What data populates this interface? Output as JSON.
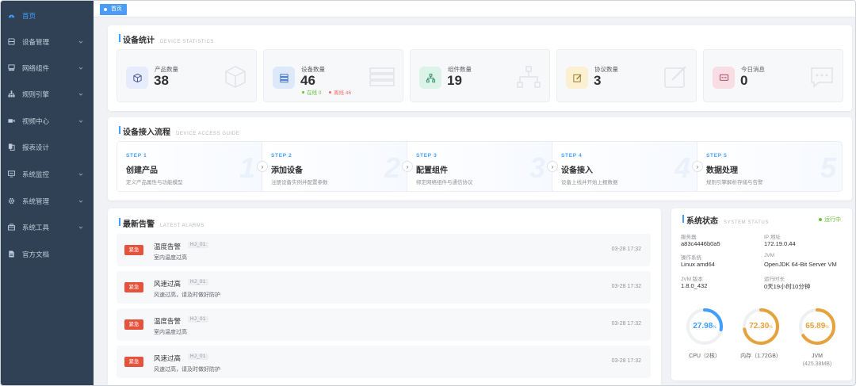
{
  "sidebar": {
    "items": [
      {
        "label": "首页",
        "icon": "dashboard-icon",
        "has_children": false
      },
      {
        "label": "设备管理",
        "icon": "device-icon",
        "has_children": true
      },
      {
        "label": "网络组件",
        "icon": "network-icon",
        "has_children": true
      },
      {
        "label": "规则引擎",
        "icon": "rule-icon",
        "has_children": true
      },
      {
        "label": "视频中心",
        "icon": "video-icon",
        "has_children": true
      },
      {
        "label": "报表设计",
        "icon": "report-icon",
        "has_children": false
      },
      {
        "label": "系统监控",
        "icon": "monitor-icon",
        "has_children": true
      },
      {
        "label": "系统管理",
        "icon": "gear-icon",
        "has_children": true
      },
      {
        "label": "系统工具",
        "icon": "toolbox-icon",
        "has_children": true
      },
      {
        "label": "官方文档",
        "icon": "document-icon",
        "has_children": false
      }
    ]
  },
  "tabs": [
    {
      "label": "首页"
    }
  ],
  "stats_section": {
    "title": "设备统计",
    "subtitle": "DEVICE STATISTICS",
    "cards": [
      {
        "label": "产品数量",
        "value": "38",
        "icon": "cube-icon",
        "color": "#e6ecfb"
      },
      {
        "label": "设备数量",
        "value": "46",
        "icon": "server-icon",
        "color": "#dde9fb",
        "online": "在线 0",
        "offline": "离线 46"
      },
      {
        "label": "组件数量",
        "value": "19",
        "icon": "topology-icon",
        "color": "#dcf3ea"
      },
      {
        "label": "协议数量",
        "value": "3",
        "icon": "edit-icon",
        "color": "#fbf0d2"
      },
      {
        "label": "今日消息",
        "value": "0",
        "icon": "message-icon",
        "color": "#f9dde4"
      }
    ]
  },
  "guide_section": {
    "title": "设备接入流程",
    "subtitle": "DEVICE ACCESS GUIDE",
    "steps": [
      {
        "no": "STEP 1",
        "title": "创建产品",
        "desc": "定义产品属性与功能模型",
        "big": "1"
      },
      {
        "no": "STEP 2",
        "title": "添加设备",
        "desc": "注册设备实例并配置参数",
        "big": "2"
      },
      {
        "no": "STEP 3",
        "title": "配置组件",
        "desc": "绑定网络组件与通信协议",
        "big": "3"
      },
      {
        "no": "STEP 4",
        "title": "设备接入",
        "desc": "设备上线并开始上报数据",
        "big": "4"
      },
      {
        "no": "STEP 5",
        "title": "数据处理",
        "desc": "规则引擎解析存储与告警",
        "big": "5"
      }
    ]
  },
  "alarm_section": {
    "title": "最新告警",
    "subtitle": "LATEST ALARMS",
    "items": [
      {
        "level": "紧急",
        "title": "温度告警",
        "code": "HJ_01",
        "desc": "室内温度过高",
        "time": "03-28 17:32"
      },
      {
        "level": "紧急",
        "title": "风速过高",
        "code": "HJ_01",
        "desc": "风速过高，请及时做好防护",
        "time": "03-28 17:32"
      },
      {
        "level": "紧急",
        "title": "温度告警",
        "code": "HJ_01",
        "desc": "室内温度过高",
        "time": "03-28 17:32"
      },
      {
        "level": "紧急",
        "title": "风速过高",
        "code": "HJ_01",
        "desc": "风速过高，请及时做好防护",
        "time": "03-28 17:32"
      }
    ]
  },
  "system_section": {
    "title": "系统状态",
    "subtitle": "SYSTEM STATUS",
    "status": "运行中",
    "status_color": "#67c23a",
    "info": [
      {
        "key": "服务器",
        "value": "a83c4446b0a5"
      },
      {
        "key": "IP 地址",
        "value": "172.19.0.44"
      },
      {
        "key": "操作系统",
        "value": "Linux amd64"
      },
      {
        "key": "JVM",
        "value": "OpenJDK 64-Bit Server VM"
      },
      {
        "key": "JVM 版本",
        "value": "1.8.0_432"
      },
      {
        "key": "运行时长",
        "value": "0天19小时10分钟"
      }
    ],
    "gauges": [
      {
        "value": "27.98",
        "unit": "%",
        "percent": 27.98,
        "color": "#409eff",
        "label": "CPU（2核）",
        "label2": ""
      },
      {
        "value": "72.30",
        "unit": "%",
        "percent": 72.3,
        "color": "#e6a23c",
        "label": "内存（1.72GB）",
        "label2": ""
      },
      {
        "value": "65.89",
        "unit": "%",
        "percent": 65.89,
        "color": "#e6a23c",
        "label": "JVM",
        "label2": "(425.38MB)"
      }
    ]
  }
}
